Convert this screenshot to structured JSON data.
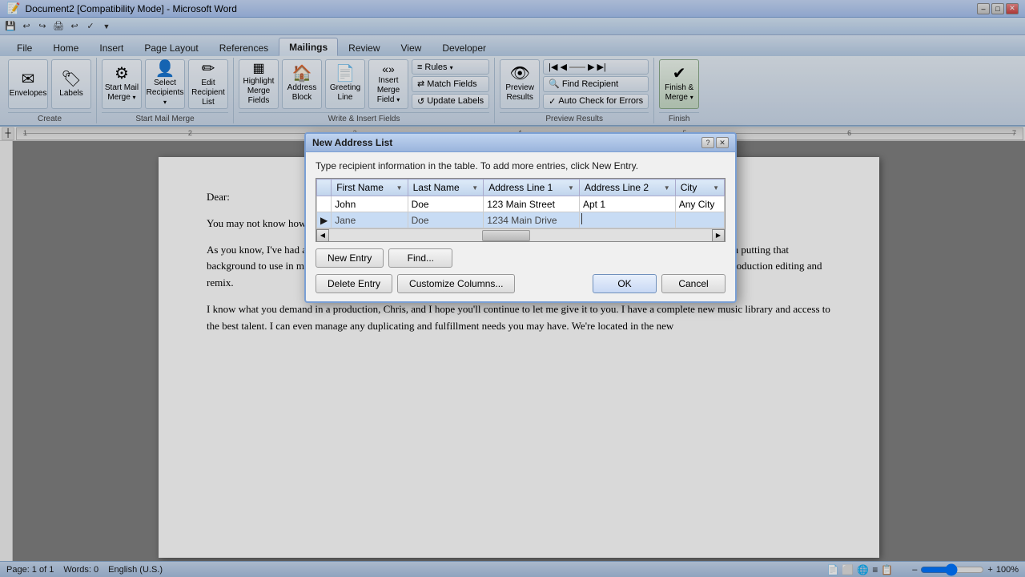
{
  "window": {
    "title": "Document2 [Compatibility Mode] - Microsoft Word",
    "controls": [
      "–",
      "□",
      "✕"
    ]
  },
  "quickaccess": {
    "icons": [
      "💾",
      "↩",
      "↪",
      "🖨",
      "↩",
      "✓"
    ]
  },
  "ribbon": {
    "tabs": [
      "File",
      "Home",
      "Insert",
      "Page Layout",
      "References",
      "Mailings",
      "Review",
      "View",
      "Developer"
    ],
    "active_tab": "Mailings",
    "groups": [
      {
        "label": "Create",
        "buttons": [
          {
            "type": "large",
            "icon": "✉",
            "label": "Envelopes"
          },
          {
            "type": "large",
            "icon": "🏷",
            "label": "Labels"
          }
        ]
      },
      {
        "label": "Start Mail Merge",
        "buttons": [
          {
            "type": "large",
            "icon": "⚙",
            "label": "Start Mail\nMerge ▾"
          },
          {
            "type": "large",
            "icon": "👤",
            "label": "Select\nRecipients ▾"
          },
          {
            "type": "large",
            "icon": "✏",
            "label": "Edit\nRecipient List"
          }
        ]
      },
      {
        "label": "Write & Insert Fields",
        "buttons": [
          {
            "type": "small",
            "icon": "▦",
            "label": "Highlight\nMerge Fields"
          },
          {
            "type": "small",
            "icon": "🏠",
            "label": "Address\nBlock"
          },
          {
            "type": "small",
            "icon": "📄",
            "label": "Greeting\nLine"
          },
          {
            "type": "small",
            "icon": "«»",
            "label": "Insert Merge\nField ▾"
          },
          {
            "type": "col",
            "buttons": [
              {
                "label": "Rules ▾"
              },
              {
                "label": "Match Fields"
              },
              {
                "label": "Update Labels"
              }
            ]
          }
        ]
      },
      {
        "label": "Preview Results",
        "buttons": [
          {
            "type": "large",
            "icon": "👁",
            "label": "Preview\nResults"
          },
          {
            "type": "col",
            "buttons": [
              {
                "label": "◀ ▶ ▶|"
              },
              {
                "label": "Find Recipient"
              },
              {
                "label": "✓ Auto Check for Errors"
              }
            ]
          }
        ]
      },
      {
        "label": "Finish",
        "buttons": [
          {
            "type": "large",
            "icon": "✔",
            "label": "Finish &\nMerge ▾"
          }
        ]
      }
    ]
  },
  "status_bar": {
    "page": "Page: 1 of 1",
    "words": "Words: 0",
    "language": "English (U.S.)"
  },
  "document": {
    "paragraphs": [
      "Dear:",
      "You may not know how much time has passed, but it's been a long time. I hope you'll become familiar quickly.",
      "As you know, I've had a long career in the music industry working with you. We've worked together for almost 10 of them.) I'm putting that background to use in my new company, producing radio spots and live and remote recordings and handling all facets of post-production editing and remix.",
      "I know what you demand in a production, Chris, and I hope you'll continue to let me give it to you. I have a complete new music library and access to the best talent. I can even manage any duplicating and fulfillment needs you may have. We're located in the new"
    ]
  },
  "dialog": {
    "title": "New Address List",
    "instruction": "Type recipient information in the table.  To add more entries, click New Entry.",
    "table": {
      "columns": [
        "First Name",
        "Last Name",
        "Address Line 1",
        "Address Line 2",
        "City"
      ],
      "rows": [
        {
          "selected": false,
          "indicator": "",
          "cells": [
            "John",
            "Doe",
            "123  Main Street",
            "Apt 1",
            "Any City"
          ]
        },
        {
          "selected": true,
          "indicator": "▶",
          "cells": [
            "Jane",
            "Doe",
            "1234 Main Drive",
            "",
            ""
          ]
        }
      ]
    },
    "buttons_row1": [
      "New Entry",
      "Find...",
      "",
      "",
      "",
      ""
    ],
    "buttons_row2": [
      "Delete Entry",
      "Customize Columns...",
      "OK",
      "Cancel"
    ],
    "controls": [
      "?",
      "✕"
    ]
  }
}
